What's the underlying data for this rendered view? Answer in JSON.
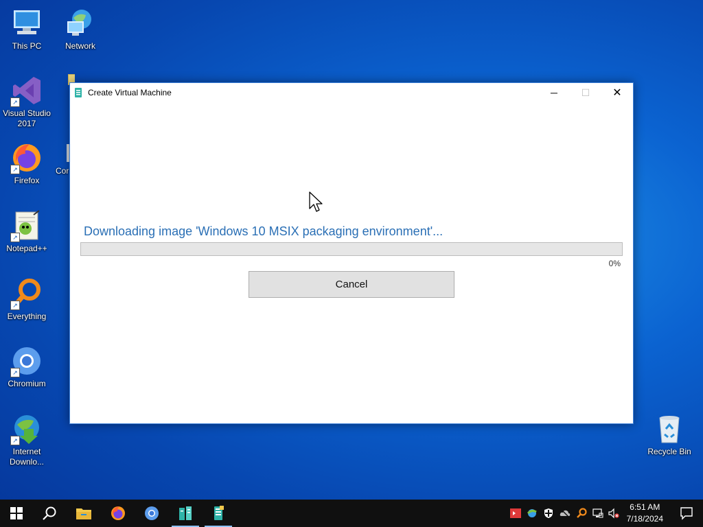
{
  "desktop": {
    "icons": [
      {
        "label": "This PC"
      },
      {
        "label": "Network"
      },
      {
        "label": "Visual Studio 2017"
      },
      {
        "label": "Firefox"
      },
      {
        "label": "Cor"
      },
      {
        "label": "Notepad++"
      },
      {
        "label": "Everything"
      },
      {
        "label": "Chromium"
      },
      {
        "label": "Internet Downlo..."
      },
      {
        "label": "Recycle Bin"
      }
    ]
  },
  "window": {
    "title": "Create Virtual Machine",
    "minimize_glyph": "─",
    "maximize_glyph": "☐",
    "close_glyph": "✕",
    "progress_label": "Downloading image 'Windows 10 MSIX packaging environment'...",
    "progress_value": 0,
    "progress_percent_text": "0%",
    "cancel_label": "Cancel"
  },
  "taskbar": {
    "items": [
      {
        "icon": "windows-start-icon"
      },
      {
        "icon": "search-icon"
      },
      {
        "icon": "file-explorer-icon"
      },
      {
        "icon": "firefox-icon"
      },
      {
        "icon": "chromium-icon"
      },
      {
        "icon": "hyper-v-manager-icon"
      },
      {
        "icon": "hyper-v-quick-create-icon"
      }
    ],
    "tray_icons": [
      "remote-icon",
      "network-sync-icon",
      "security-shield-icon",
      "cloud-offline-icon",
      "search-everything-icon",
      "network-icon",
      "volume-muted-icon"
    ],
    "time": "6:51 AM",
    "date": "7/18/2024"
  },
  "colors": {
    "accent": "#2a6fb5",
    "taskbar": "#101010",
    "progress_fill": "#06b025"
  }
}
